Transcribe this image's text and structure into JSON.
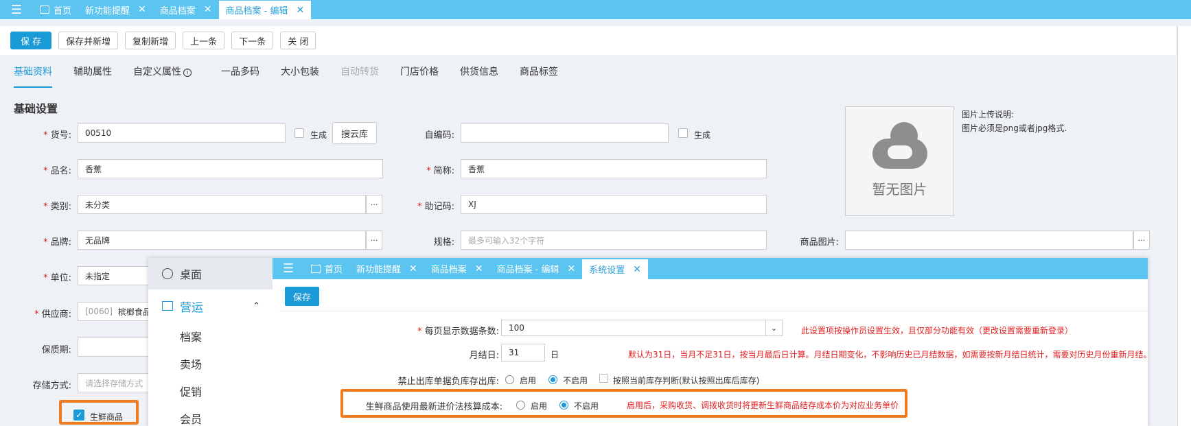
{
  "tabs": [
    {
      "label": "首页",
      "home": true
    },
    {
      "label": "新功能提醒",
      "closable": true
    },
    {
      "label": "商品档案",
      "closable": true
    },
    {
      "label": "商品档案 - 编辑",
      "closable": true,
      "active": true
    }
  ],
  "toolbar": {
    "save": "保 存",
    "save_new": "保存并新增",
    "copy_new": "复制新增",
    "prev": "上一条",
    "next": "下一条",
    "close": "关 闭"
  },
  "subtabs": [
    "基础资料",
    "辅助属性",
    "自定义属性",
    "一品多码",
    "大小包装",
    "自动转货",
    "门店价格",
    "供货信息",
    "商品标签"
  ],
  "section_title": "基础设置",
  "form": {
    "item_no": {
      "label": "货号:",
      "value": "00510"
    },
    "generate": "生成",
    "search_cloud": "搜云库",
    "self_code": {
      "label": "自编码:",
      "value": ""
    },
    "name": {
      "label": "品名:",
      "value": "香蕉"
    },
    "short_name": {
      "label": "简称:",
      "value": "香蕉"
    },
    "category": {
      "label": "类别:",
      "value": "未分类"
    },
    "mnemonic": {
      "label": "助记码:",
      "value": "XJ"
    },
    "brand": {
      "label": "品牌:",
      "value": "无品牌"
    },
    "spec": {
      "label": "规格:",
      "placeholder": "最多可输入32个字符"
    },
    "product_image": {
      "label": "商品图片:"
    },
    "unit": {
      "label": "单位:",
      "value": "未指定"
    },
    "supplier": {
      "label": "供应商:",
      "code": "[0060]",
      "value": "槟榔食品"
    },
    "shelf_life": {
      "label": "保质期:"
    },
    "storage": {
      "label": "存储方式:",
      "placeholder": "请选择存储方式"
    },
    "fresh": "生鲜商品",
    "dots": "···"
  },
  "image": {
    "no_image": "暂无图片",
    "upload_title": "图片上传说明:",
    "upload_note": "图片必须是png或者jpg格式."
  },
  "overlay": {
    "sidebar": {
      "desk": "桌面",
      "group": "营运",
      "items": [
        "档案",
        "卖场",
        "促销",
        "会员"
      ]
    },
    "tabs": [
      {
        "label": "首页",
        "home": true
      },
      {
        "label": "新功能提醒",
        "closable": true
      },
      {
        "label": "商品档案",
        "closable": true
      },
      {
        "label": "商品档案 - 编辑",
        "closable": true
      },
      {
        "label": "系统设置",
        "closable": true,
        "active": true
      }
    ],
    "save": "保存",
    "rows": {
      "page_size": {
        "label": "每页显示数据条数:",
        "value": "100",
        "note": "此设置项按操作员设置生效，且仅部分功能有效（更改设置需要重新登录）"
      },
      "month_end": {
        "label": "月结日:",
        "value": "31",
        "unit": "日",
        "note": "默认为31日，当月不足31日，按当月最后日计算。月结日期变化，不影响历史已月结数据，如需要按新月结日统计，需要对历史月份重新月结。"
      },
      "negative": {
        "label": "禁止出库单据负库存出库:",
        "on": "启用",
        "off": "不启用",
        "check": "按照当前库存判断(默认按照出库后库存)"
      },
      "fresh_cost": {
        "label": "生鲜商品使用最新进价法核算成本:",
        "on": "启用",
        "off": "不启用",
        "note": "启用后，采购收货、调拨收货时将更新生鲜商品结存成本价为对应业务单价"
      }
    }
  }
}
